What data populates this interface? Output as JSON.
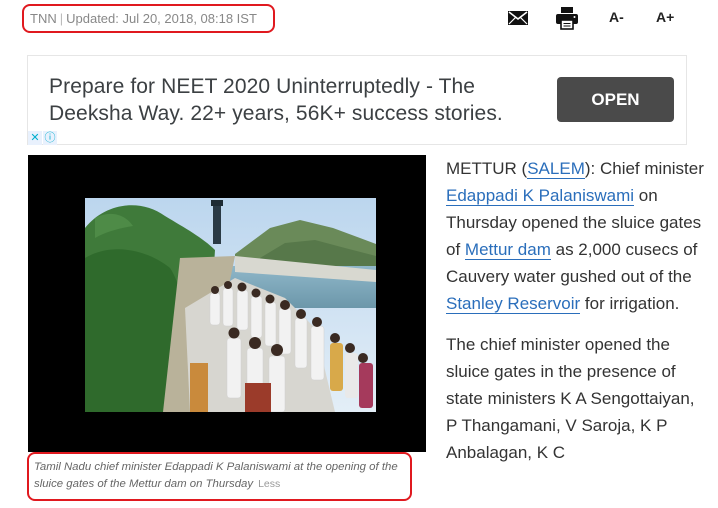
{
  "byline": {
    "source": "TNN",
    "separator": "|",
    "updated": "Updated: Jul 20, 2018, 08:18 IST"
  },
  "toolbar": {
    "font_decrease": "A-",
    "font_increase": "A+",
    "mail_icon": "mail-icon",
    "print_icon": "print-icon"
  },
  "ad": {
    "text": "Prepare for NEET 2020 Uninterruptedly - The Deeksha Way. 22+ years, 56K+ success stories.",
    "button": "OPEN",
    "close_glyph": "✕",
    "info_glyph": "ⓘ"
  },
  "photo": {
    "caption": "Tamil Nadu chief minister Edappadi K Palaniswami at the opening of the sluice gates of the Mettur dam on Thursday",
    "less": "Less"
  },
  "article": {
    "p1": {
      "t0": "METTUR (",
      "link_salem": "SALEM",
      "t1": "): Chief minister ",
      "link_cm": "Edappadi K Palaniswami",
      "t2": " on Thursday opened the sluice gates of ",
      "link_dam": "Mettur dam",
      "t3": " as 2,000 cusecs of Cauvery water gushed out of the ",
      "link_reservoir": "Stanley Reservoir",
      "t4": " for irrigation."
    },
    "p2": "The chief minister opened the sluice gates in the presence of state ministers K A Sengottaiyan, P Thangamani, V Saroja, K P Anbalagan, K C"
  }
}
